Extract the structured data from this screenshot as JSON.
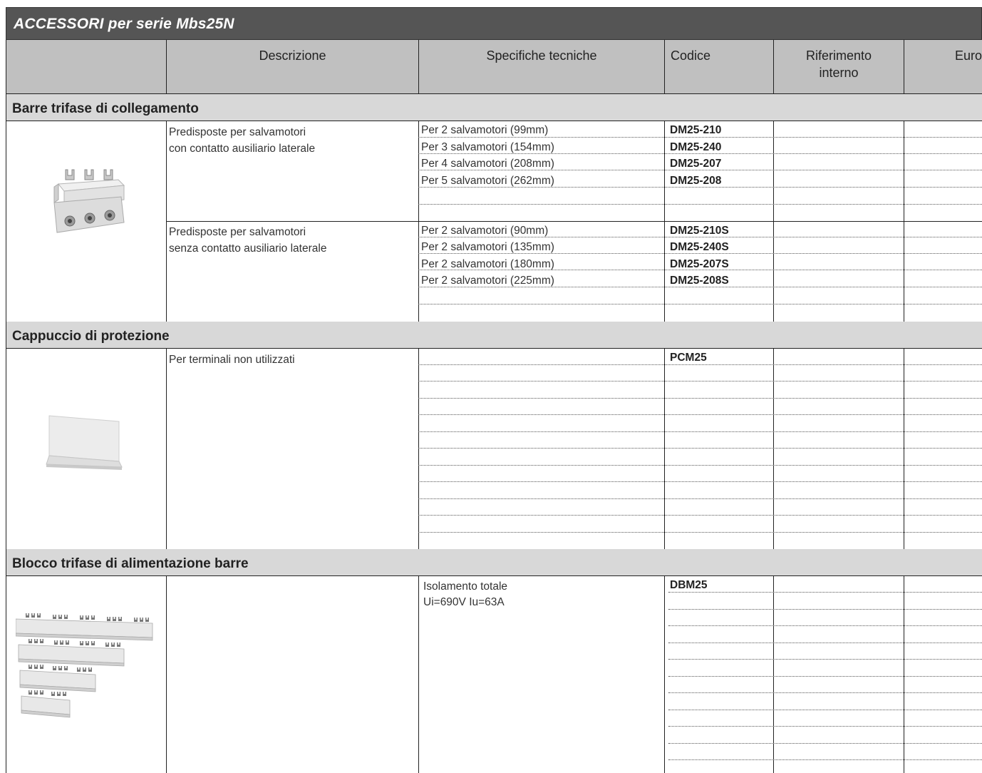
{
  "title": "ACCESSORI per serie Mbs25N",
  "columns": {
    "descrizione": "Descrizione",
    "specifiche": "Specifiche tecniche",
    "codice": "Codice",
    "riferimento": "Riferimento interno",
    "euro": "Euro"
  },
  "sections": [
    {
      "name": "Barre trifase di collegamento",
      "image": "busbar-3-pole-icon",
      "groups": [
        {
          "description": [
            "Predisposte per salvamotori",
            "con contatto ausiliario laterale"
          ],
          "rows": [
            {
              "spec": "Per 2 salvamotori (99mm)",
              "code": "DM25-210"
            },
            {
              "spec": "Per 3 salvamotori (154mm)",
              "code": "DM25-240"
            },
            {
              "spec": "Per 4 salvamotori (208mm)",
              "code": "DM25-207"
            },
            {
              "spec": "Per 5 salvamotori (262mm)",
              "code": "DM25-208"
            }
          ]
        },
        {
          "description": [
            "Predisposte per salvamotori",
            "senza contatto ausiliario laterale"
          ],
          "rows": [
            {
              "spec": "Per 2 salvamotori (90mm)",
              "code": "DM25-210S"
            },
            {
              "spec": "Per 2 salvamotori (135mm)",
              "code": "DM25-240S"
            },
            {
              "spec": "Per 2 salvamotori (180mm)",
              "code": "DM25-207S"
            },
            {
              "spec": "Per 2 salvamotori (225mm)",
              "code": "DM25-208S"
            }
          ]
        }
      ]
    },
    {
      "name": "Cappuccio di protezione",
      "image": "protection-cap-icon",
      "description": "Per terminali non utilizzati",
      "code": "PCM25"
    },
    {
      "name": "Blocco trifase di alimentazione barre",
      "image": "busbar-set-icon",
      "spec": [
        "Isolamento totale",
        "Ui=690V  Iu=63A"
      ],
      "code": "DBM25"
    }
  ]
}
